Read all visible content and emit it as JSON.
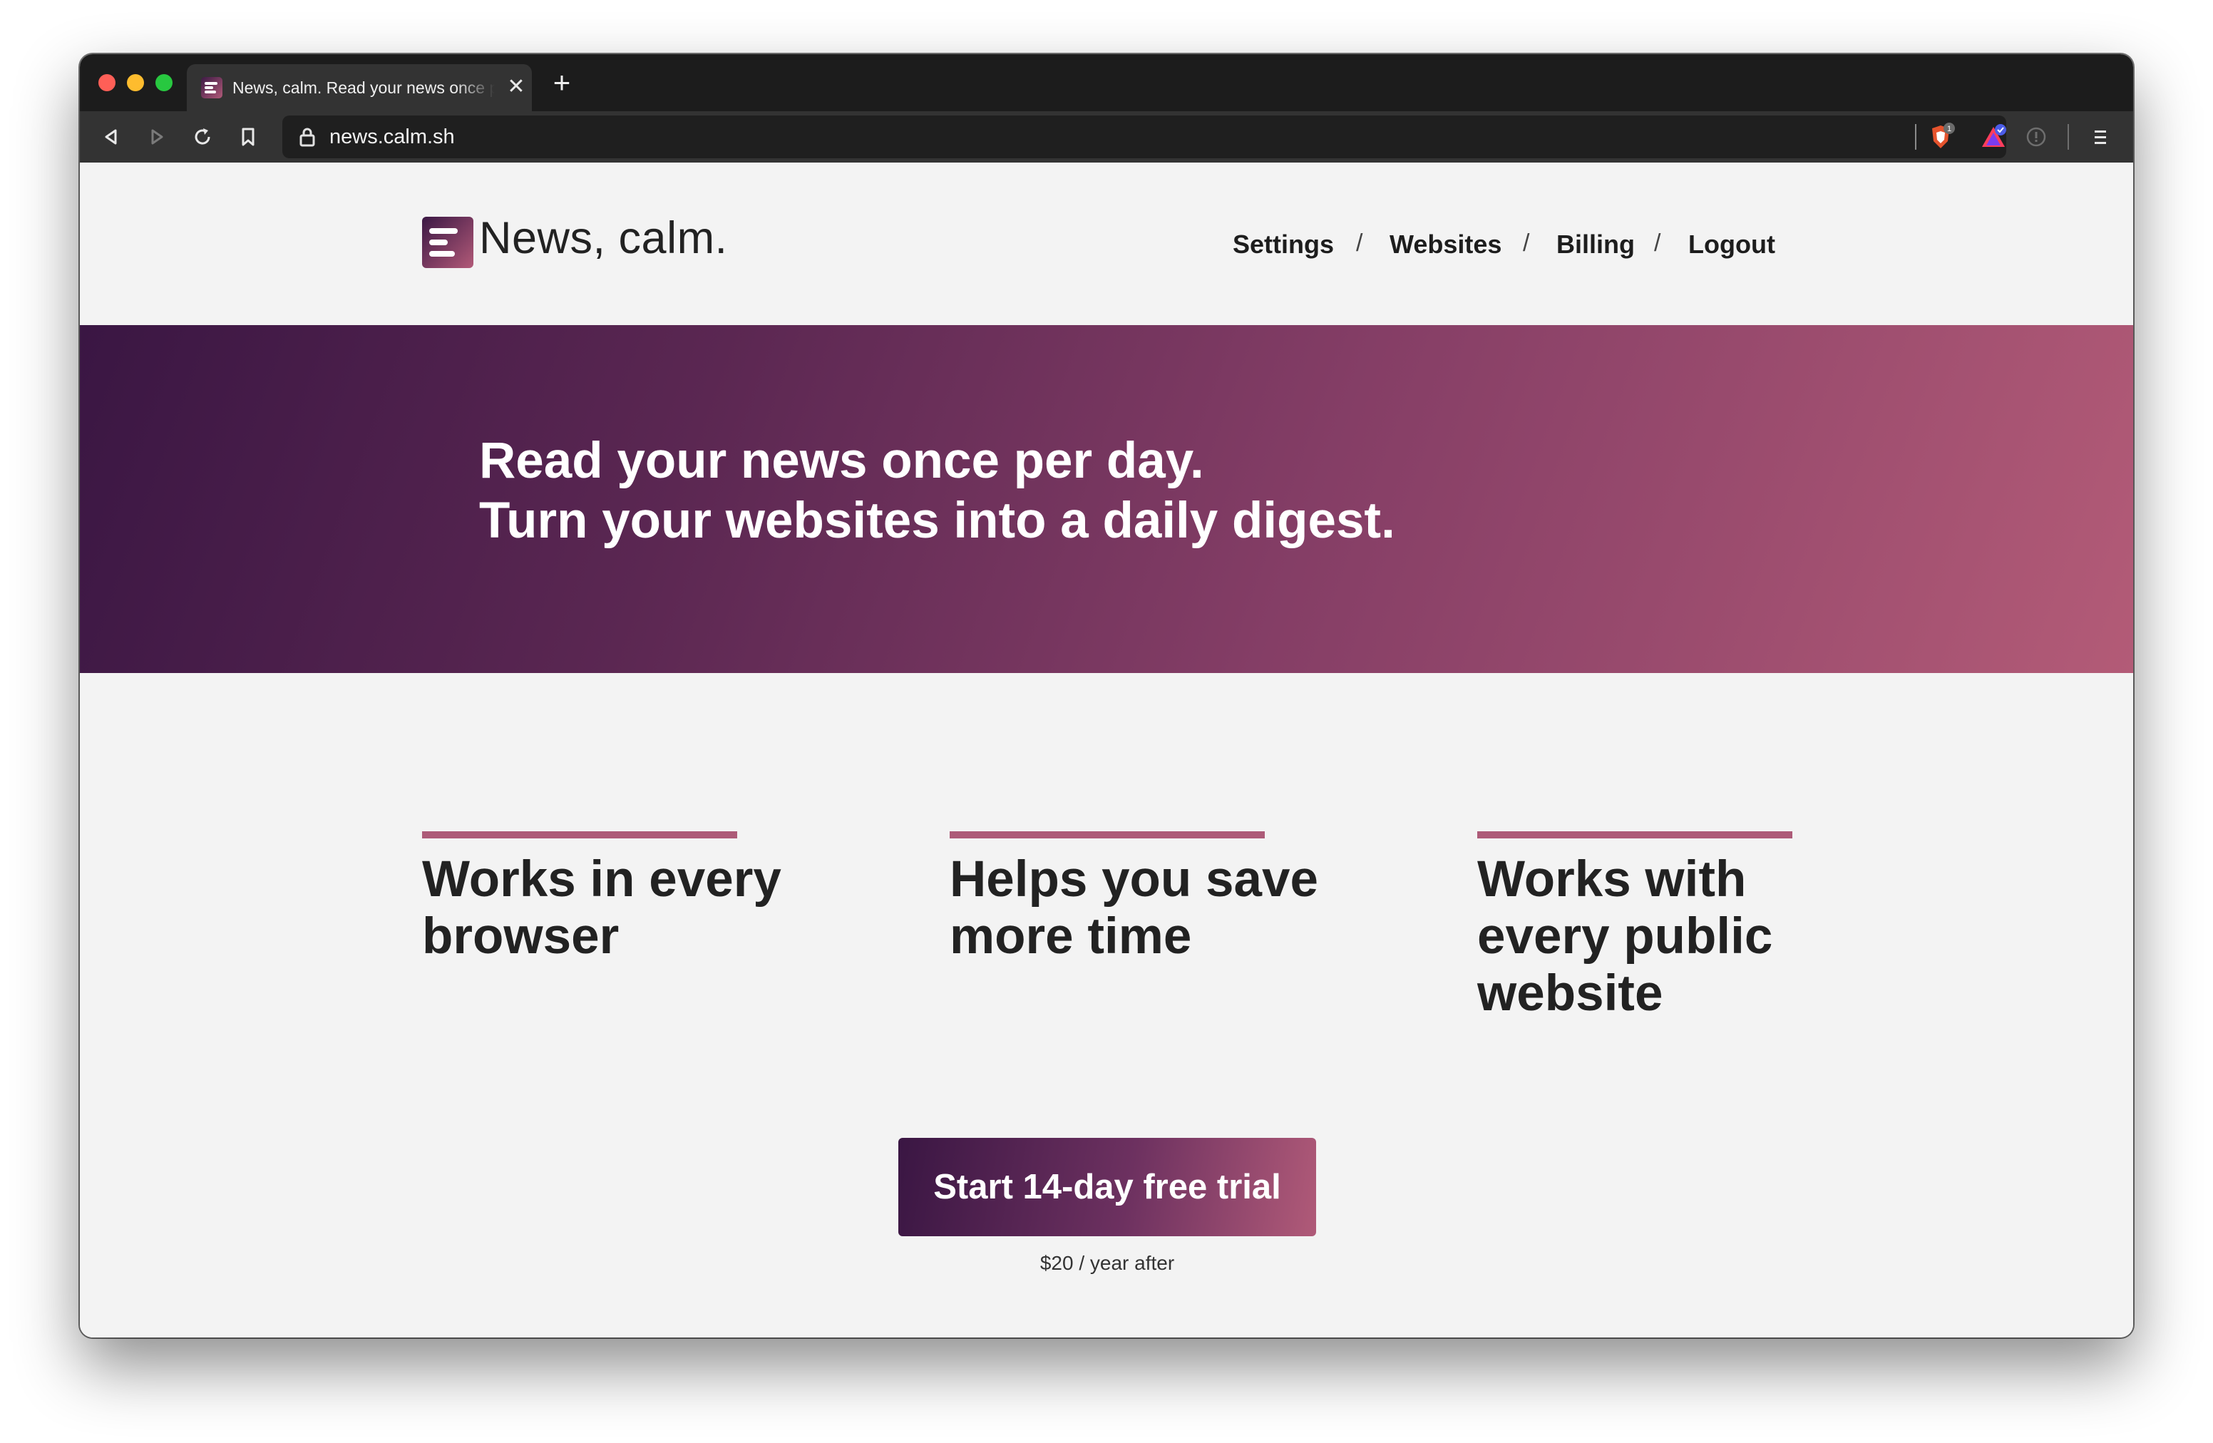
{
  "browser": {
    "tab_title": "News, calm. Read your news once per day",
    "tab_close": "✕",
    "new_tab": "+",
    "url": "news.calm.sh"
  },
  "header": {
    "brand": "News, calm.",
    "nav": [
      {
        "label": "Settings"
      },
      {
        "label": "Websites"
      },
      {
        "label": "Billing"
      },
      {
        "label": "Logout"
      }
    ],
    "separator": "/"
  },
  "hero": {
    "line1": "Read your news once per day.",
    "line2": "Turn your websites into a daily digest."
  },
  "features": [
    {
      "title": "Works in every browser"
    },
    {
      "title": "Helps you save more time"
    },
    {
      "title": "Works with every public website"
    }
  ],
  "cta": {
    "label": "Start 14-day free trial",
    "note": "$20 / year after"
  },
  "colors": {
    "accent_dark": "#3a1643",
    "accent_light": "#b35b77",
    "page_bg": "#f3f3f3"
  },
  "icons": [
    "back-icon",
    "forward-icon",
    "reload-icon",
    "bookmark-icon",
    "lock-icon",
    "brave-shield-icon",
    "brave-rewards-icon",
    "wallet-icon",
    "menu-icon"
  ]
}
